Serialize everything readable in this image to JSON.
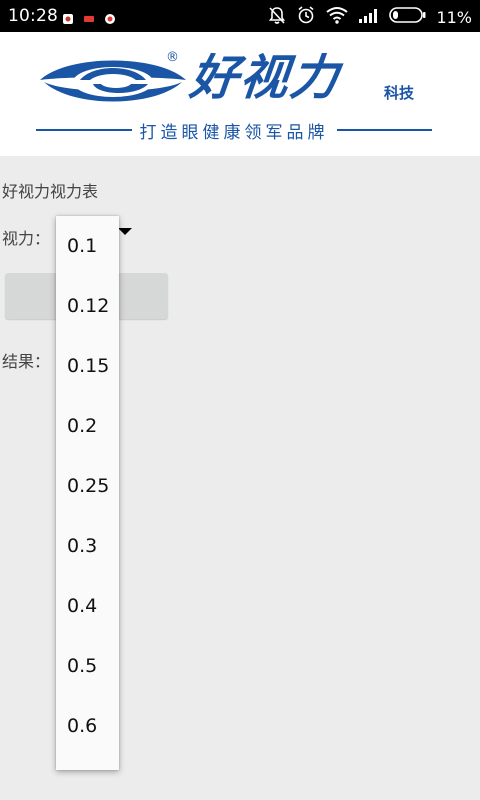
{
  "status_bar": {
    "time": "10:28",
    "battery_percent": "11%",
    "icons": [
      "notification-icon",
      "notification-icon",
      "notification-icon",
      "mute-icon",
      "alarm-icon",
      "wifi-icon",
      "signal-icon",
      "battery-icon"
    ]
  },
  "banner": {
    "brand_name": "好视力",
    "brand_suffix": "科技",
    "registered_mark": "®",
    "slogan": "打造眼健康领军品牌",
    "brand_color": "#1b56a6"
  },
  "main": {
    "title": "好视力视力表",
    "vision_label": "视力：",
    "result_label": "结果："
  },
  "dropdown": {
    "options": [
      "0.1",
      "0.12",
      "0.15",
      "0.2",
      "0.25",
      "0.3",
      "0.4",
      "0.5",
      "0.6"
    ]
  }
}
